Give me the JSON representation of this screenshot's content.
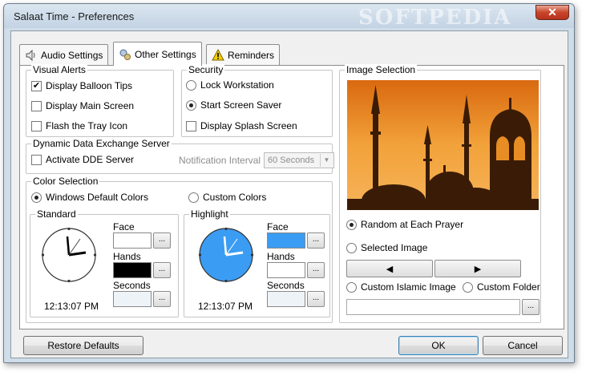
{
  "window": {
    "title": "Salaat Time - Preferences",
    "watermark": "SOFTPEDIA",
    "close_glyph": "✕"
  },
  "tabs": [
    {
      "label": "Audio Settings",
      "icon": "speaker-icon",
      "active": false
    },
    {
      "label": "Other Settings",
      "icon": "gears-icon",
      "active": true
    },
    {
      "label": "Reminders",
      "icon": "warning-icon",
      "active": false
    }
  ],
  "visual_alerts": {
    "title": "Visual Alerts",
    "items": [
      {
        "label": "Display Balloon Tips",
        "checked": true
      },
      {
        "label": "Display Main Screen",
        "checked": false
      },
      {
        "label": "Flash the Tray Icon",
        "checked": false
      }
    ]
  },
  "security": {
    "title": "Security",
    "items": [
      {
        "label": "Lock Workstation",
        "selected": false
      },
      {
        "label": "Start Screen Saver",
        "selected": true
      }
    ],
    "splash": {
      "label": "Display Splash Screen",
      "checked": false
    }
  },
  "dde": {
    "title": "Dynamic Data Exchange Server",
    "activate_label": "Activate DDE Server",
    "interval_label": "Notification Interval",
    "interval_value": "60 Seconds"
  },
  "color_selection": {
    "title": "Color Selection",
    "windows_default_label": "Windows Default Colors",
    "custom_label": "Custom Colors",
    "standard": {
      "title": "Standard",
      "face_label": "Face",
      "hands_label": "Hands",
      "seconds_label": "Seconds",
      "face_color": "#ffffff",
      "hands_color": "#000000",
      "seconds_color": "#eef3f8",
      "time": "12:13:07 PM"
    },
    "highlight": {
      "title": "Highlight",
      "face_label": "Face",
      "hands_label": "Hands",
      "seconds_label": "Seconds",
      "face_color": "#3b9cf3",
      "hands_color": "#ffffff",
      "seconds_color": "#eef3f8",
      "time": "12:13:07 PM"
    },
    "dots": "..."
  },
  "image_selection": {
    "title": "Image Selection",
    "random_label": "Random at Each Prayer",
    "selected_label": "Selected Image",
    "prev_glyph": "◀",
    "next_glyph": "▶",
    "custom_islamic_label": "Custom Islamic Image",
    "custom_folder_label": "Custom Folder",
    "path_value": "",
    "dots": "..."
  },
  "footer": {
    "restore_label": "Restore Defaults",
    "ok_label": "OK",
    "cancel_label": "Cancel"
  },
  "colors": {
    "window_frame": "#cfdde9",
    "sunset_sky": "#e78a1c",
    "accent_blue": "#3b9cf3"
  }
}
